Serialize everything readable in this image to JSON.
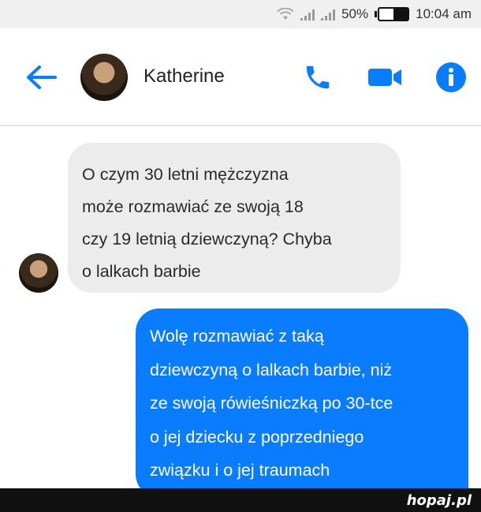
{
  "status_bar": {
    "battery": "50%",
    "time": "10:04 am",
    "battery_fill": 0.5
  },
  "header": {
    "contact_name": "Katherine"
  },
  "messages": [
    {
      "direction": "incoming",
      "lines": [
        "O czym 30 letni mężczyzna",
        "może rozmawiać ze swoją 18",
        "czy 19 letnią dziewczyną? Chyba",
        "o lalkach barbie"
      ]
    },
    {
      "direction": "outgoing",
      "lines": [
        "Wolę rozmawiać z taką",
        "dziewczyną o lalkach barbie, niż",
        "ze swoją rówieśniczką po 30-tce",
        "o jej dziecku z poprzedniego",
        "związku i o jej traumach"
      ]
    }
  ],
  "watermark": {
    "text": "hopaj.pl"
  },
  "colors": {
    "accent": "#0a7cff",
    "incoming_bubble": "#ececec"
  },
  "icons": [
    "wifi-icon",
    "signal-icon",
    "battery-icon",
    "back-arrow-icon",
    "phone-icon",
    "video-icon",
    "info-icon"
  ]
}
